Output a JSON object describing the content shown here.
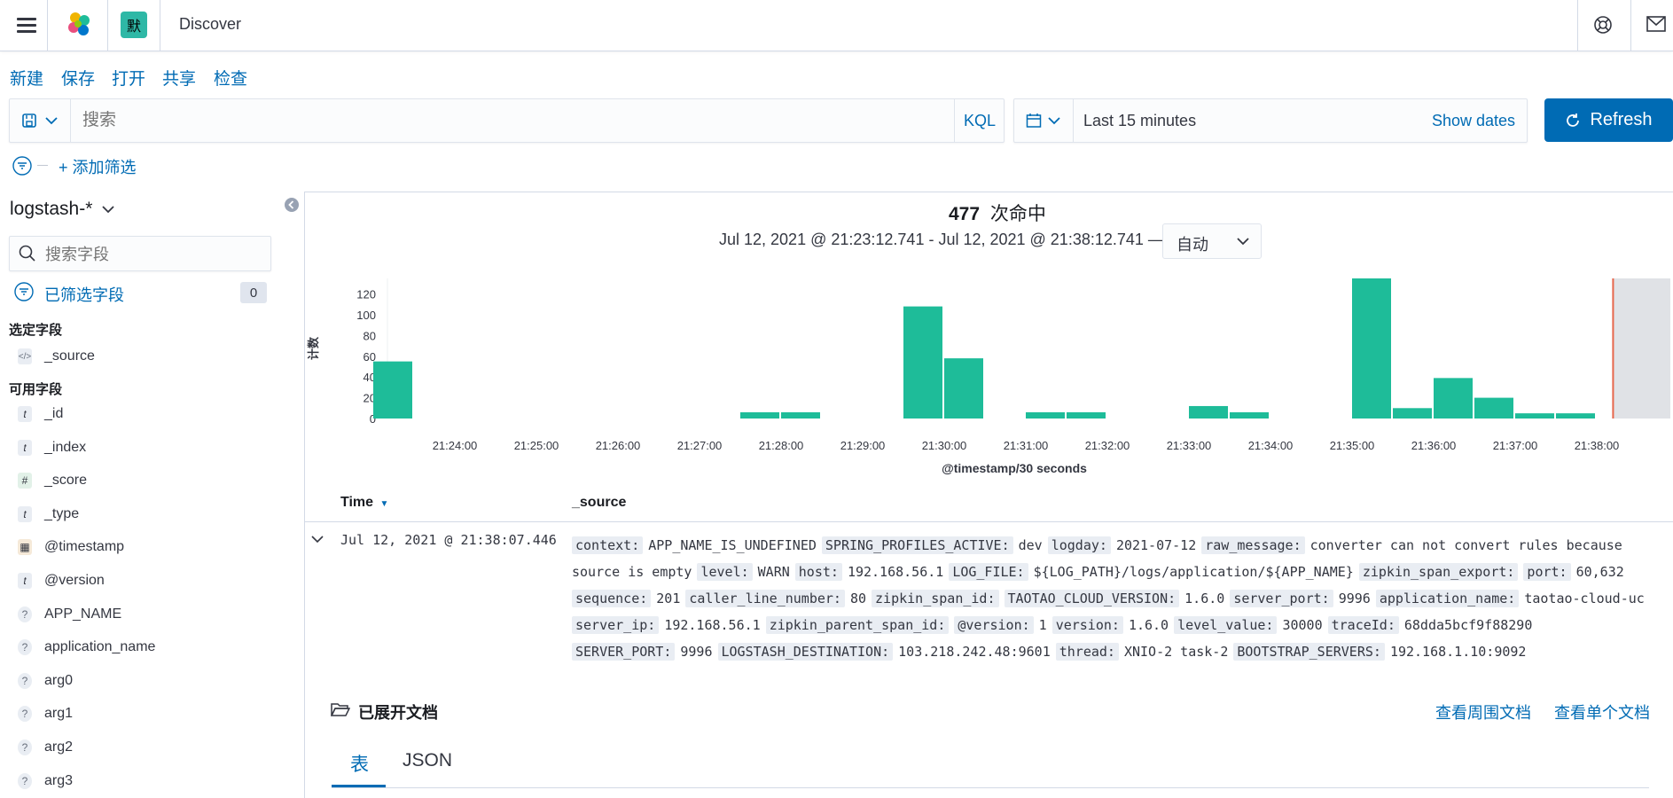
{
  "header": {
    "space_initial": "默",
    "app_title": "Discover",
    "icons": [
      "menu-icon",
      "elastic-logo-icon",
      "help-icon",
      "mail-icon"
    ]
  },
  "menu": {
    "new": "新建",
    "save": "保存",
    "open": "打开",
    "share": "共享",
    "inspect": "检查"
  },
  "query": {
    "placeholder": "搜索",
    "language": "KQL"
  },
  "time": {
    "range": "Last 15 minutes",
    "show_dates": "Show dates",
    "refresh": "Refresh"
  },
  "filters": {
    "add": "+ 添加筛选"
  },
  "sidebar": {
    "index_pattern": "logstash-*",
    "search_placeholder": "搜索字段",
    "filtered_fields_label": "已筛选字段",
    "filtered_count": "0",
    "selected_title": "选定字段",
    "selected_fields": [
      {
        "type": "source",
        "icon": "</>",
        "name": "_source"
      }
    ],
    "available_title": "可用字段",
    "available_fields": [
      {
        "type": "string",
        "icon": "t",
        "name": "_id"
      },
      {
        "type": "string",
        "icon": "t",
        "name": "_index"
      },
      {
        "type": "number",
        "icon": "#",
        "name": "_score"
      },
      {
        "type": "string",
        "icon": "t",
        "name": "_type"
      },
      {
        "type": "date",
        "icon": "▦",
        "name": "@timestamp"
      },
      {
        "type": "string",
        "icon": "t",
        "name": "@version"
      },
      {
        "type": "unknown",
        "icon": "?",
        "name": "APP_NAME"
      },
      {
        "type": "unknown",
        "icon": "?",
        "name": "application_name"
      },
      {
        "type": "unknown",
        "icon": "?",
        "name": "arg0"
      },
      {
        "type": "unknown",
        "icon": "?",
        "name": "arg1"
      },
      {
        "type": "unknown",
        "icon": "?",
        "name": "arg2"
      },
      {
        "type": "unknown",
        "icon": "?",
        "name": "arg3"
      }
    ]
  },
  "results": {
    "hits": "477",
    "hits_label": "次命中",
    "time_range": "Jul 12, 2021 @ 21:23:12.741 - Jul 12, 2021 @ 21:38:12.741 —",
    "interval": "自动"
  },
  "chart_data": {
    "type": "bar",
    "title": "",
    "xlabel": "@timestamp/30 seconds",
    "ylabel": "计数",
    "ylim": [
      0,
      135
    ],
    "yticks": [
      0,
      20,
      40,
      60,
      80,
      100,
      120
    ],
    "xticks": [
      "21:24:00",
      "21:25:00",
      "21:26:00",
      "21:27:00",
      "21:28:00",
      "21:29:00",
      "21:30:00",
      "21:31:00",
      "21:32:00",
      "21:33:00",
      "21:34:00",
      "21:35:00",
      "21:36:00",
      "21:37:00",
      "21:38:00"
    ],
    "bars": [
      {
        "x": "21:23:30",
        "value": 55
      },
      {
        "x": "21:28:00",
        "value": 6
      },
      {
        "x": "21:28:30",
        "value": 6
      },
      {
        "x": "21:30:00",
        "value": 108
      },
      {
        "x": "21:30:30",
        "value": 58
      },
      {
        "x": "21:31:30",
        "value": 6
      },
      {
        "x": "21:32:00",
        "value": 6
      },
      {
        "x": "21:33:30",
        "value": 12
      },
      {
        "x": "21:34:00",
        "value": 6
      },
      {
        "x": "21:35:30",
        "value": 135
      },
      {
        "x": "21:36:00",
        "value": 10
      },
      {
        "x": "21:36:30",
        "value": 39
      },
      {
        "x": "21:37:00",
        "value": 20
      },
      {
        "x": "21:37:30",
        "value": 5
      },
      {
        "x": "21:38:00",
        "value": 5
      }
    ],
    "bar_color": "#1ebc99",
    "current_time_marker": "21:38:12",
    "grid": false
  },
  "table": {
    "col_time": "Time",
    "col_source": "_source",
    "row": {
      "time": "Jul 12, 2021 @ 21:38:07.446",
      "source_lines": [
        [
          [
            "context:",
            "APP_NAME_IS_UNDEFINED"
          ],
          [
            "SPRING_PROFILES_ACTIVE:",
            "dev"
          ],
          [
            "logday:",
            "2021-07-12"
          ],
          [
            "raw_message:",
            "converter can not convert rules because"
          ]
        ],
        [
          [
            "",
            "source is empty"
          ],
          [
            "level:",
            "WARN"
          ],
          [
            "host:",
            "192.168.56.1"
          ],
          [
            "LOG_FILE:",
            "${LOG_PATH}/logs/application/${APP_NAME}"
          ],
          [
            "zipkin_span_export:",
            ""
          ],
          [
            "port:",
            "60,632"
          ]
        ],
        [
          [
            "sequence:",
            "201"
          ],
          [
            "caller_line_number:",
            "80"
          ],
          [
            "zipkin_span_id:",
            ""
          ],
          [
            "TAOTAO_CLOUD_VERSION:",
            "1.6.0"
          ],
          [
            "server_port:",
            "9996"
          ],
          [
            "application_name:",
            "taotao-cloud-uc"
          ]
        ],
        [
          [
            "server_ip:",
            "192.168.56.1"
          ],
          [
            "zipkin_parent_span_id:",
            ""
          ],
          [
            "@version:",
            "1"
          ],
          [
            "version:",
            "1.6.0"
          ],
          [
            "level_value:",
            "30000"
          ],
          [
            "traceId:",
            "68dda5bcf9f88290"
          ]
        ],
        [
          [
            "SERVER_PORT:",
            "9996"
          ],
          [
            "LOGSTASH_DESTINATION:",
            "103.218.242.48:9601"
          ],
          [
            "thread:",
            "XNIO-2 task-2"
          ],
          [
            "BOOTSTRAP_SERVERS:",
            "192.168.1.10:9092"
          ]
        ]
      ]
    }
  },
  "detail": {
    "title": "已展开文档",
    "surrounding": "查看周围文档",
    "single": "查看单个文档",
    "tab_table": "表",
    "tab_json": "JSON"
  },
  "colors": {
    "accent": "#006bb4",
    "bar": "#1ebc99",
    "marker": "#e7664c"
  }
}
